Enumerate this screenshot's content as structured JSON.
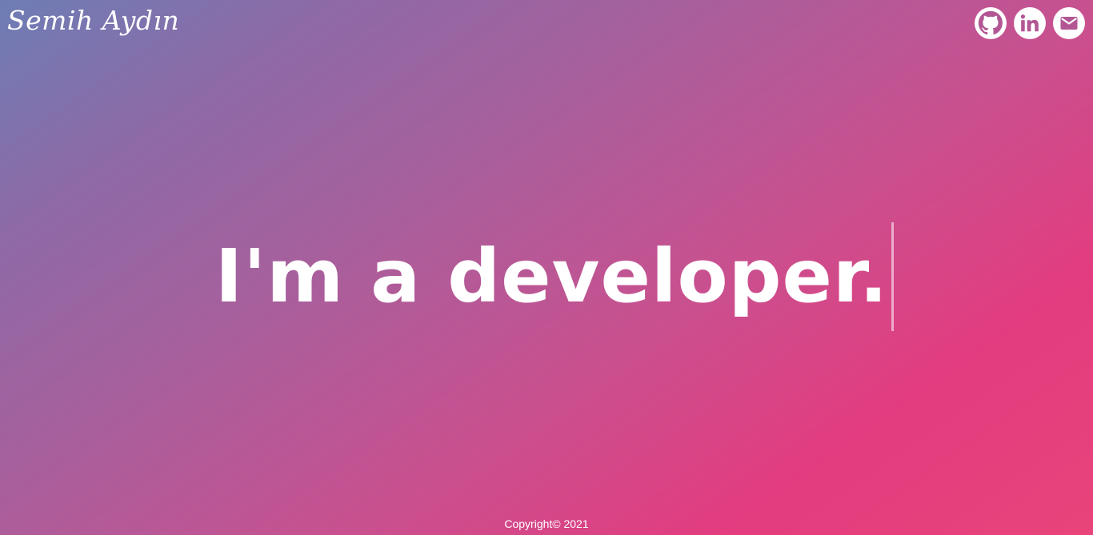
{
  "header": {
    "brand": "Semih Aydın"
  },
  "socials": [
    {
      "icon": "github-icon"
    },
    {
      "icon": "linkedin-icon"
    },
    {
      "icon": "mail-icon"
    }
  ],
  "hero": {
    "text": "I'm a developer."
  },
  "footer": {
    "copyright": "Copyright© 2021"
  },
  "colors": {
    "gradient_start": "#6e7db5",
    "gradient_mid": "#a85f9c",
    "gradient_end": "#e8447a",
    "icon_fill": "#a85f9c",
    "text": "#ffffff"
  }
}
